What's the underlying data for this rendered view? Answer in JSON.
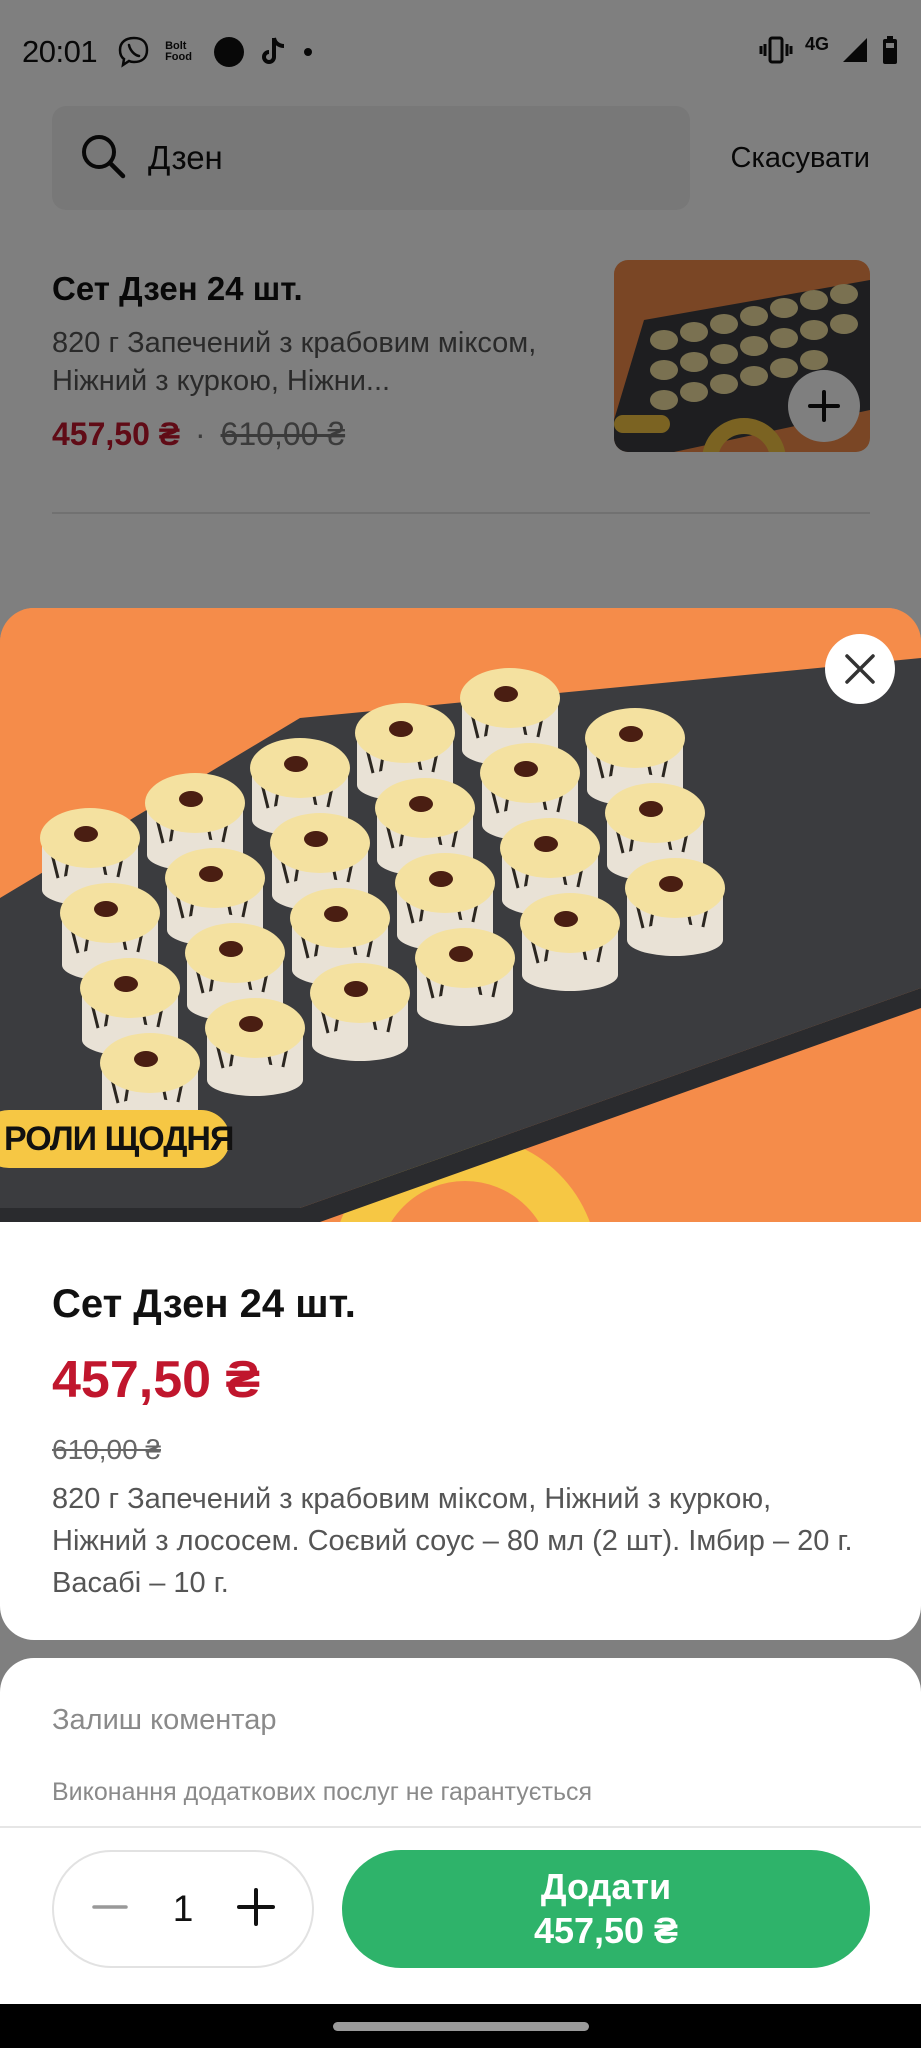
{
  "status_bar": {
    "time": "20:01",
    "apps": [
      "viber-icon",
      "bolt-food-icon",
      "circle-icon",
      "tiktok-icon",
      "dot-icon"
    ],
    "bolt_food_text": "Bolt Food",
    "network": "4G"
  },
  "search": {
    "query": "Дзен",
    "cancel_label": "Скасувати"
  },
  "result": {
    "title": "Сет Дзен 24 шт.",
    "description": "820 г Запечений з крабовим міксом, Ніжний з куркою, Ніжни...",
    "price": "457,50 ₴",
    "separator": "·",
    "old_price": "610,00 ₴"
  },
  "product": {
    "image_banner": "РОЛИ ЩОДНЯ",
    "title": "Сет Дзен 24 шт.",
    "price": "457,50 ₴",
    "old_price": "610,00 ₴",
    "description": "820 г Запечений з крабовим міксом, Ніжний з куркою, Ніжний з лососем. Соєвий соус – 80 мл (2 шт). Імбир – 20 г. Васабі – 10 г."
  },
  "comment": {
    "label": "Залиш коментар",
    "note": "Виконання додаткових послуг не гарантується"
  },
  "order": {
    "quantity": "1",
    "add_label": "Додати",
    "add_price": "457,50 ₴"
  },
  "colors": {
    "accent_green": "#2eb36a",
    "price_red": "#c0162d",
    "hero_orange": "#f58c4a"
  }
}
